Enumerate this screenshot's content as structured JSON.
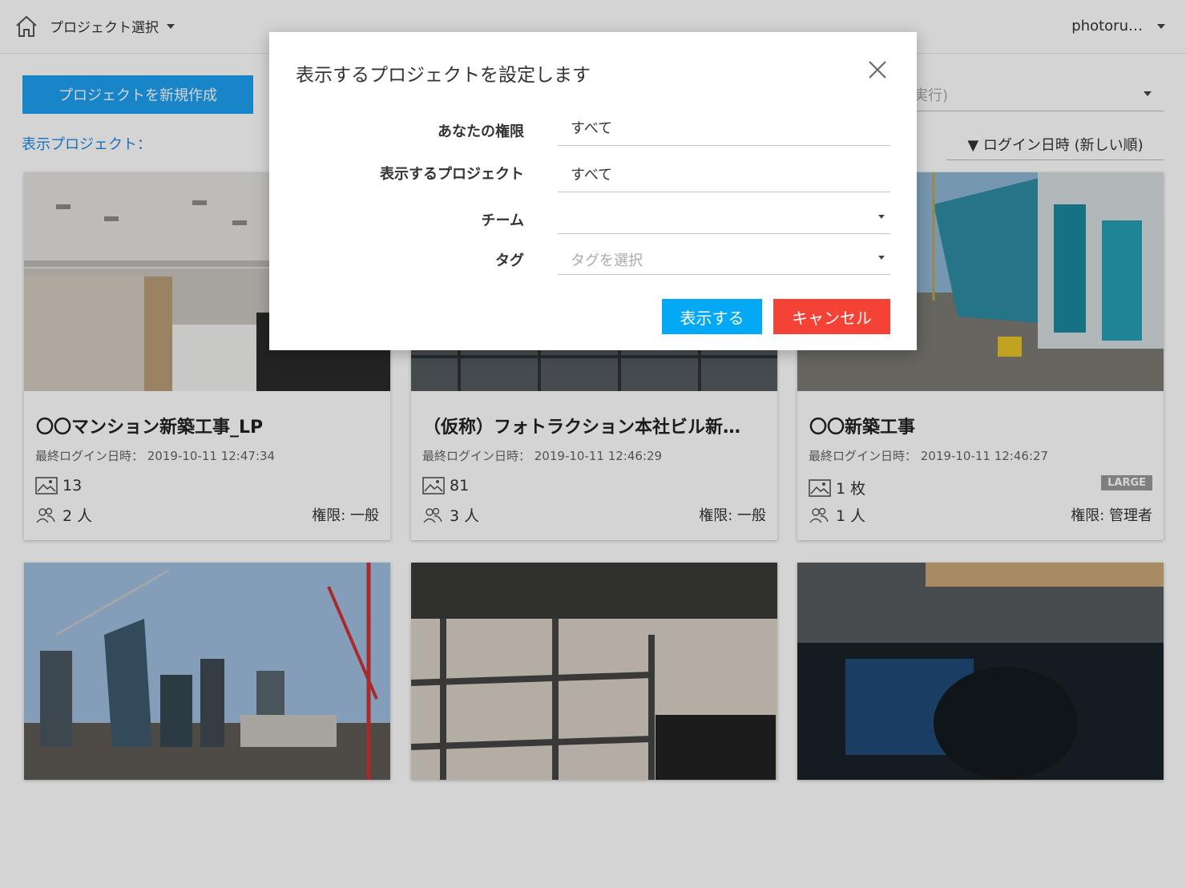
{
  "header": {
    "project_select_label": "プロジェクト選択",
    "user_label": "photoru…"
  },
  "toolbar": {
    "new_project_label": "プロジェクトを新規作成",
    "shown_projects_label": "表示プロジェクト：",
    "search_partial_text": "実行)",
    "sort_label": "▼ ログイン日時 (新しい順)"
  },
  "projects": [
    {
      "title": "〇〇マンション新築工事_LP",
      "last_login": "最終ログイン日時： 2019-10-11 12:47:34",
      "photos": "13",
      "members": "2 人",
      "permission": "権限: 一般",
      "badge": ""
    },
    {
      "title": "（仮称）フォトラクション本社ビル新…",
      "last_login": "最終ログイン日時： 2019-10-11 12:46:29",
      "photos": "81",
      "members": "3 人",
      "permission": "権限: 一般",
      "badge": ""
    },
    {
      "title": "〇〇新築工事",
      "last_login": "最終ログイン日時： 2019-10-11 12:46:27",
      "photos": "1 枚",
      "members": "1 人",
      "permission": "権限: 管理者",
      "badge": "LARGE"
    }
  ],
  "modal": {
    "title": "表示するプロジェクトを設定します",
    "permission_label": "あなたの権限",
    "permission_value": "すべて",
    "project_label": "表示するプロジェクト",
    "project_value": "すべて",
    "team_label": "チーム",
    "team_value": "",
    "tag_label": "タグ",
    "tag_placeholder": "タグを選択",
    "show_button": "表示する",
    "cancel_button": "キャンセル"
  },
  "colors": {
    "primary_button": "#1da1f2",
    "show_button": "#03a9f4",
    "cancel_button": "#f44336",
    "link": "#1e88e5"
  }
}
